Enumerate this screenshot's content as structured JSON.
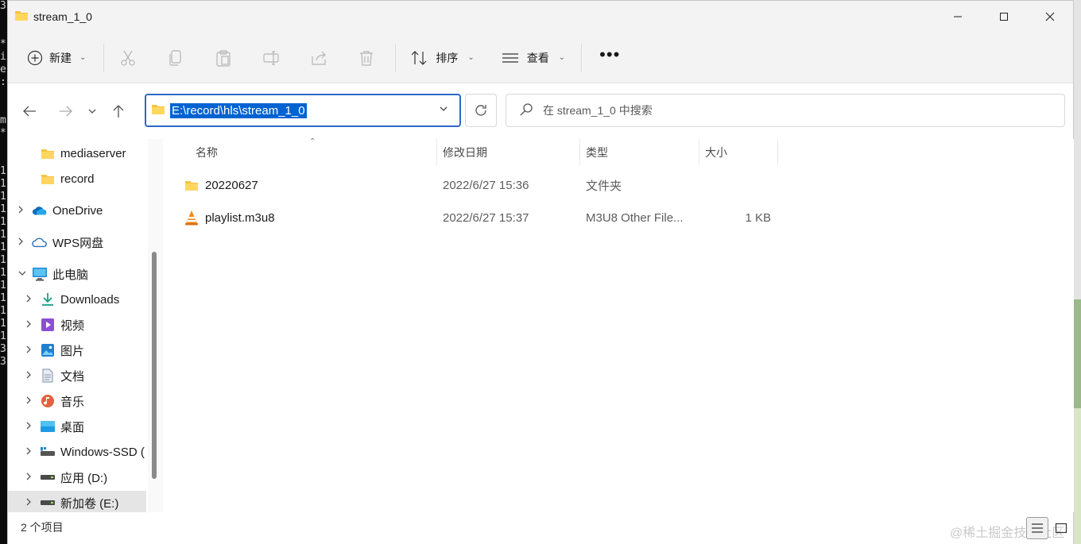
{
  "background": {
    "terminal_chars": [
      "3",
      "",
      "",
      "*",
      "i",
      "e",
      ":",
      "",
      "",
      "m",
      "*",
      "",
      "",
      "1",
      "1",
      "1",
      "1",
      "1",
      "1",
      "1",
      "1",
      "1",
      "1",
      "1",
      "1",
      "1",
      "1",
      "3",
      "3"
    ]
  },
  "window": {
    "title": "stream_1_0",
    "controls": {
      "minimize": "—",
      "maximize": "☐",
      "close": "✕"
    }
  },
  "toolbar": {
    "new_label": "新建",
    "sort_label": "排序",
    "view_label": "查看",
    "more_label": "•••"
  },
  "address": {
    "path": "E:\\record\\hls\\stream_1_0",
    "search_placeholder": "在 stream_1_0 中搜索"
  },
  "sidebar": {
    "items": [
      {
        "label": "mediaserver",
        "icon": "folder-icon",
        "expandable": false
      },
      {
        "label": "record",
        "icon": "folder-icon",
        "expandable": false
      },
      {
        "label": "OneDrive",
        "icon": "onedrive-cloud-icon",
        "expandable": true,
        "expanded": false
      },
      {
        "label": "WPS网盘",
        "icon": "wps-cloud-icon",
        "expandable": true,
        "expanded": false
      },
      {
        "label": "此电脑",
        "icon": "computer-icon",
        "expandable": true,
        "expanded": true
      },
      {
        "label": "Downloads",
        "icon": "download-icon",
        "expandable": true,
        "expanded": false
      },
      {
        "label": "视频",
        "icon": "video-icon",
        "expandable": true,
        "expanded": false
      },
      {
        "label": "图片",
        "icon": "picture-icon",
        "expandable": true,
        "expanded": false
      },
      {
        "label": "文档",
        "icon": "document-icon",
        "expandable": true,
        "expanded": false
      },
      {
        "label": "音乐",
        "icon": "music-icon",
        "expandable": true,
        "expanded": false
      },
      {
        "label": "桌面",
        "icon": "desktop-icon",
        "expandable": true,
        "expanded": false
      },
      {
        "label": "Windows-SSD (",
        "icon": "system-drive-icon",
        "expandable": true,
        "expanded": false
      },
      {
        "label": "应用 (D:)",
        "icon": "drive-icon",
        "expandable": true,
        "expanded": false
      },
      {
        "label": "新加卷 (E:)",
        "icon": "drive-icon",
        "expandable": true,
        "expanded": false,
        "selected": true
      }
    ]
  },
  "columns": {
    "name": "名称",
    "date": "修改日期",
    "type": "类型",
    "size": "大小"
  },
  "files": [
    {
      "name": "20220627",
      "date": "2022/6/27 15:36",
      "type": "文件夹",
      "size": "",
      "icon": "folder-icon"
    },
    {
      "name": "playlist.m3u8",
      "date": "2022/6/27 15:37",
      "type": "M3U8 Other File...",
      "size": "1 KB",
      "icon": "vlc-cone-icon"
    }
  ],
  "status": {
    "item_count": "2 个项目",
    "watermark": "@稀土掘金技术社区"
  }
}
